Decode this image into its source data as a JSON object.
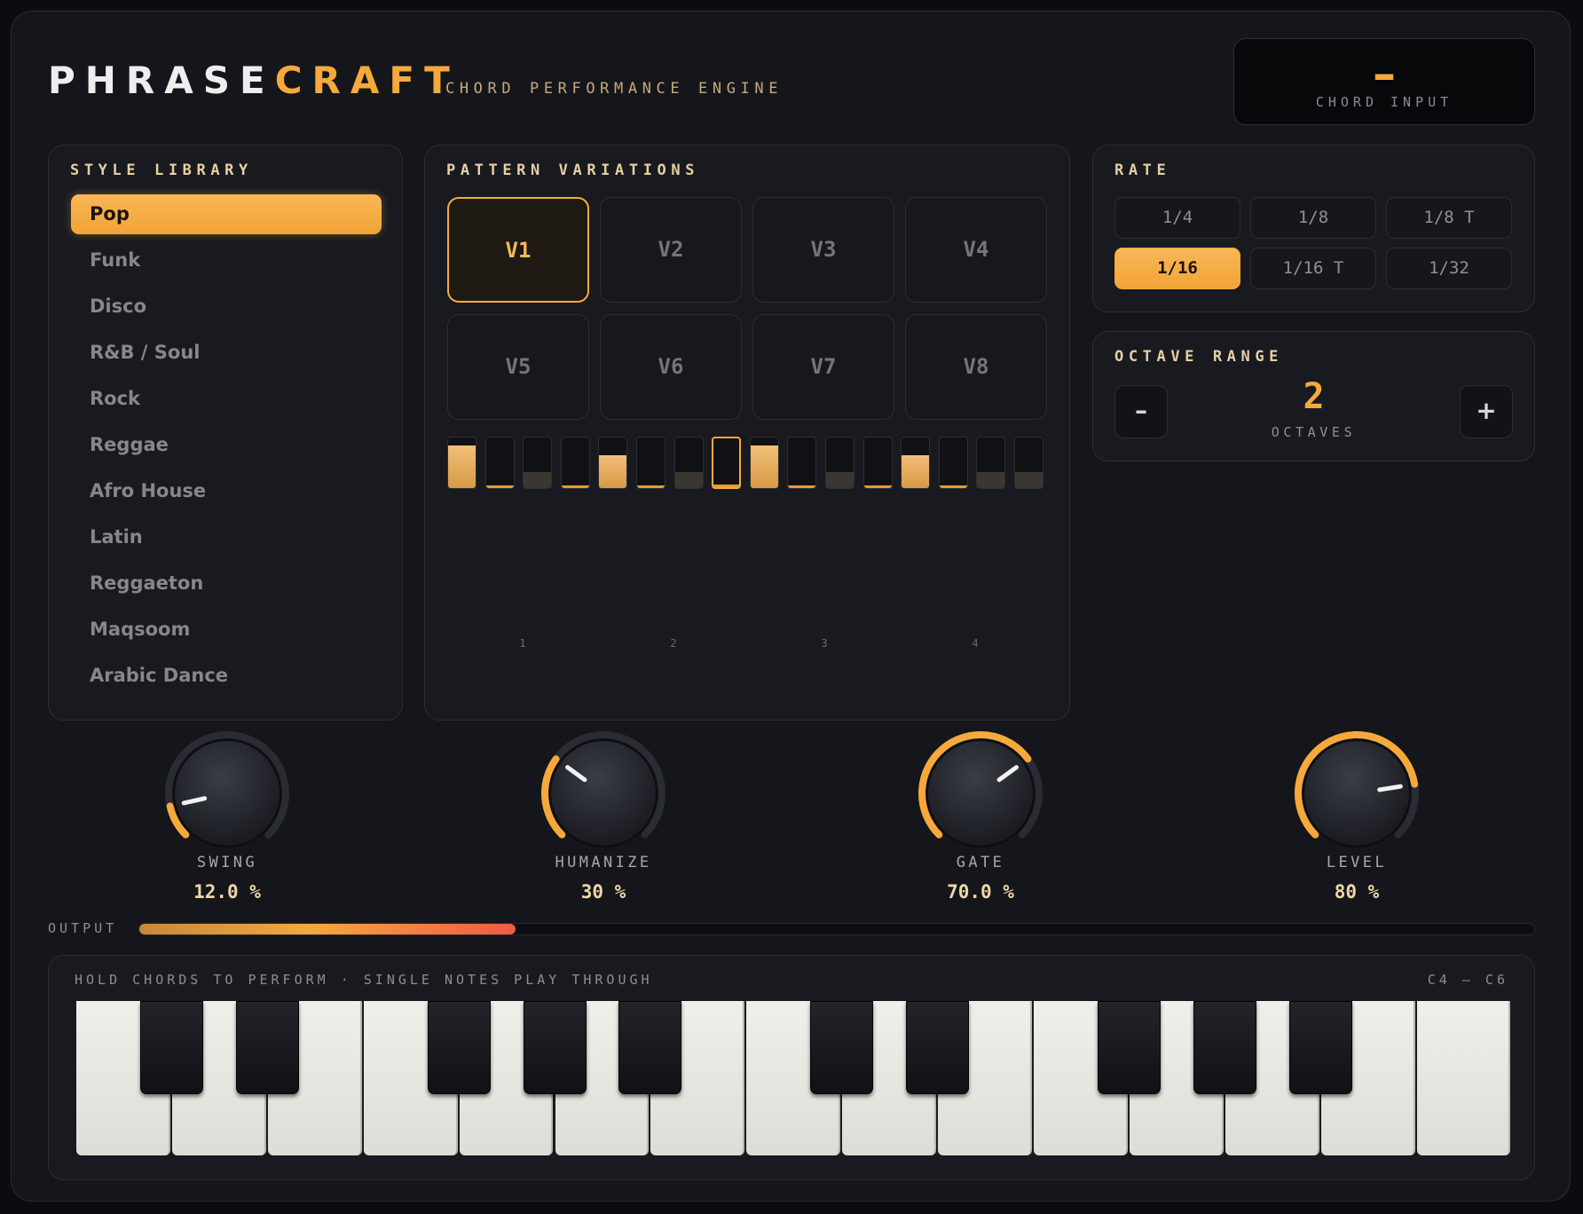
{
  "brand": {
    "part1": "PHRASE",
    "part2": "CRAFT",
    "tagline": "CHORD PERFORMANCE ENGINE"
  },
  "chord_input": {
    "value": "–",
    "label": "CHORD INPUT"
  },
  "style_library": {
    "title": "STYLE LIBRARY",
    "items": [
      "Pop",
      "Funk",
      "Disco",
      "R&B / Soul",
      "Rock",
      "Reggae",
      "Afro House",
      "Latin",
      "Reggaeton",
      "Maqsoom",
      "Arabic Dance"
    ],
    "selected": 0
  },
  "pattern_variations": {
    "title": "PATTERN VARIATIONS",
    "items": [
      "V1",
      "V2",
      "V3",
      "V4",
      "V5",
      "V6",
      "V7",
      "V8"
    ],
    "selected": 0,
    "steps": [
      0.85,
      0.06,
      0.32,
      0.06,
      0.65,
      0.06,
      0.32,
      0.06,
      0.85,
      0.06,
      0.32,
      0.06,
      0.65,
      0.06,
      0.32,
      0.32
    ],
    "current_step": 7,
    "beat_labels": [
      "1",
      "2",
      "3",
      "4"
    ]
  },
  "rate": {
    "title": "RATE",
    "items": [
      "1/4",
      "1/8",
      "1/8 T",
      "1/16",
      "1/16 T",
      "1/32"
    ],
    "selected": 3
  },
  "octave_range": {
    "title": "OCTAVE RANGE",
    "value": "2",
    "unit": "OCTAVES",
    "minus": "–",
    "plus": "+"
  },
  "knobs": [
    {
      "name": "SWING",
      "display": "12.0 %",
      "fraction": 0.12
    },
    {
      "name": "HUMANIZE",
      "display": "30 %",
      "fraction": 0.3
    },
    {
      "name": "GATE",
      "display": "70.0 %",
      "fraction": 0.7
    },
    {
      "name": "LEVEL",
      "display": "80 %",
      "fraction": 0.8
    }
  ],
  "output": {
    "label": "OUTPUT",
    "level": 0.27
  },
  "keyboard": {
    "hint": "HOLD CHORDS TO PERFORM · SINGLE NOTES PLAY THROUGH",
    "range": "C4 — C6"
  },
  "colors": {
    "accent": "#f6a93b",
    "bg": "#15161b",
    "panel": "#181a20"
  }
}
